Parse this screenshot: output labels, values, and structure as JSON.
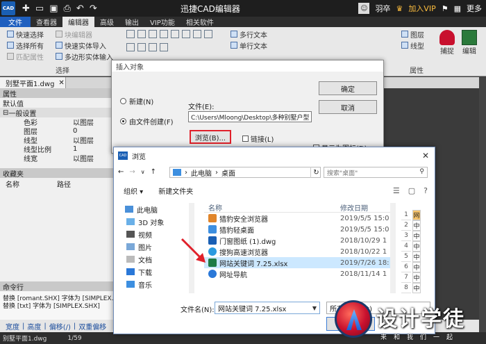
{
  "app": {
    "logo": "CAD",
    "title": "迅捷CAD编辑器",
    "user": "羽卒",
    "vip": "加入VIP",
    "more": "更多"
  },
  "menu": [
    "文件",
    "查看器",
    "编辑器",
    "高级",
    "输出",
    "VIP功能",
    "相关软件"
  ],
  "ribbon": {
    "select_group": {
      "items": [
        "快速选择",
        "选择所有",
        "匹配属性"
      ],
      "items2": [
        "块编辑器",
        "快速实体导入",
        "多边形实体输入"
      ],
      "label": "选择"
    },
    "text_group": {
      "items": [
        "多行文本",
        "单行文本"
      ]
    },
    "layer_group": {
      "items": [
        "图层",
        "线型"
      ],
      "label": "属性"
    },
    "snap": "捕捉",
    "edit": "编辑"
  },
  "doc_tab": "别墅平面1.dwg",
  "properties": {
    "title": "属性",
    "default": "默认值",
    "section": "一般设置",
    "rows": [
      {
        "k": "色彩",
        "v": "以图层"
      },
      {
        "k": "图层",
        "v": "0"
      },
      {
        "k": "线型",
        "v": "以图层"
      },
      {
        "k": "线型比例",
        "v": "1"
      },
      {
        "k": "线宽",
        "v": "以图层"
      }
    ]
  },
  "favorites": {
    "title": "收藏夹",
    "col1": "名称",
    "col2": "路径"
  },
  "command": {
    "title": "命令行",
    "lines": [
      "替换 [romant.SHX] 字体为 [SIMPLEX.SHX]",
      "替换 [txt] 字体为 [SIMPLEX.SHX]"
    ]
  },
  "options": [
    "宽度",
    "高度",
    "偏移(/)",
    "双重偏移"
  ],
  "status": {
    "doc": "别墅平面1.dwg",
    "page": "1/59"
  },
  "insert_dialog": {
    "title": "插入对象",
    "radio_new": "新建(N)",
    "radio_file": "由文件创建(F)",
    "file_label": "文件(E):",
    "file_path": "C:\\Users\\Mloong\\Desktop\\多种别墅户型",
    "browse": "浏览(B)...",
    "link": "链接(L)",
    "ok": "确定",
    "cancel": "取消",
    "show_icon": "显示为图标(D)"
  },
  "browse_dialog": {
    "title": "浏览",
    "breadcrumb": [
      "此电脑",
      "桌面"
    ],
    "search_placeholder": "搜索\"桌面\"",
    "organize": "组织 ▾",
    "new_folder": "新建文件夹",
    "nav": [
      "此电脑",
      "3D 对象",
      "视频",
      "图片",
      "文档",
      "下载",
      "音乐"
    ],
    "col_name": "名称",
    "col_date": "修改日期",
    "files": [
      {
        "name": "猎豹安全浏览器",
        "date": "2019/5/5 15:0",
        "icon": "browser-icon",
        "color": "#e0852a"
      },
      {
        "name": "猎豹轻桌面",
        "date": "2019/5/5 15:0",
        "icon": "app-icon",
        "color": "#3d8fe0"
      },
      {
        "name": "门窗图纸 (1).dwg",
        "date": "2018/10/29 1",
        "icon": "cad-file-icon",
        "color": "#1a5fb4"
      },
      {
        "name": "搜狗高速浏览器",
        "date": "2018/10/22 1",
        "icon": "browser-icon",
        "color": "#2a9ae0"
      },
      {
        "name": "网站关键词 7.25.xlsx",
        "date": "2019/7/26 18:",
        "icon": "excel-icon",
        "color": "#1e7b45"
      },
      {
        "name": "网址导航",
        "date": "2018/11/14 1",
        "icon": "ie-icon",
        "color": "#2a78d8"
      }
    ],
    "preview_rows": [
      "1",
      "2",
      "3",
      "4",
      "5",
      "6",
      "7",
      "8"
    ],
    "preview_cells": [
      "网",
      "中",
      "中",
      "中",
      "中",
      "中",
      "中",
      "中"
    ],
    "filename_label": "文件名(N):",
    "filename": "网站关键词 7.25.xlsx",
    "filetype": "所有文件(*.*)",
    "open": "打开(O)"
  },
  "watermark": {
    "big": "设计学徒",
    "small": "来和我们一起"
  }
}
